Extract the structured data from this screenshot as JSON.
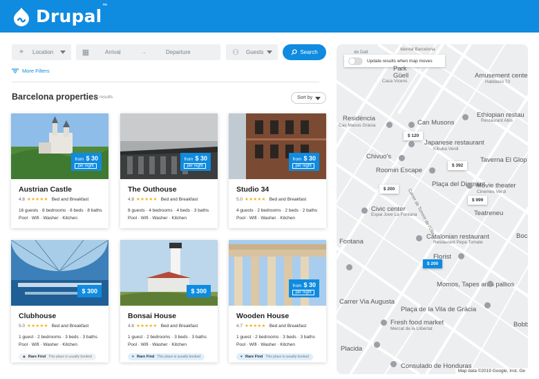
{
  "header": {
    "brand": "Drupal",
    "tm": "™"
  },
  "search": {
    "location_placeholder": "Location",
    "arrival_placeholder": "Arrival",
    "date_separator": "→",
    "departure_placeholder": "Departure",
    "guests_placeholder": "Guests",
    "search_label": "Search",
    "more_filters": "More Filters"
  },
  "results": {
    "title": "Barcelona properties",
    "count": "12 results",
    "sort_label": "Sort by"
  },
  "properties": [
    {
      "name": "Austrian Castle",
      "rating": "4.8",
      "stars": "★★★★★",
      "type": "Bed and Breakfast",
      "from": "from",
      "price": "$ 30",
      "per_night": "per night",
      "features1": "16 guests · 8 bedrooms · 8 beds · 8 baths",
      "features2": "Pool · Wifi · Washer · Kitchen"
    },
    {
      "name": "The Outhouse",
      "rating": "4.8",
      "stars": "★★★★★",
      "type": "Bed and Breakfast",
      "from": "from",
      "price": "$ 30",
      "per_night": "per night",
      "features1": "8 guests · 4 bedrooms · 4 beds · 3 baths",
      "features2": "Pool · Wifi · Washer · Kitchen"
    },
    {
      "name": "Studio 34",
      "rating": "5.0",
      "stars": "★★★★★",
      "type": "Bed and Breakfast",
      "from": "from",
      "price": "$ 30",
      "per_night": "per night",
      "features1": "4 guests · 2 bedrooms · 2 beds · 2 baths",
      "features2": "Pool · Wifi · Washer · Kitchen"
    },
    {
      "name": "Clubhouse",
      "rating": "5.0",
      "stars": "★★★★★",
      "type": "Bed and Breakfast",
      "price": "$ 300",
      "features1": "1 guest · 2 bedrooms · 3 beds · 3 baths",
      "features2": "Pool · Wifi · Washer · Kitchen",
      "badge_title": "Rare Find",
      "badge_text": "This place is usually booked"
    },
    {
      "name": "Bonsai House",
      "rating": "4.8",
      "stars": "★★★★★",
      "type": "Bed and Breakfast",
      "price": "$ 300",
      "features1": "1 guest · 2 bedrooms · 3 beds · 3 baths",
      "features2": "Pool · Wifi · Washer · Kitchen",
      "badge_title": "Rare Find",
      "badge_text": "This place is usually booked"
    },
    {
      "name": "Wooden House",
      "rating": "4.7",
      "stars": "★★★★★",
      "type": "Bed and Breakfast",
      "from": "from",
      "price": "$ 30",
      "per_night": "per night",
      "features1": "1 guest · 2 bedrooms · 3 beds · 3 baths",
      "features2": "Pool · Wifi · Washer · Kitchen",
      "badge_title": "Rare Find",
      "badge_text": "This place is usually booked"
    }
  ],
  "map": {
    "toggle_label": "Update results when map moves",
    "labels": [
      "Park",
      "Güell",
      "Casa Vicens",
      "Amusement center",
      "Habitacio 73",
      "Residència",
      "Cas Masos Gràcia",
      "Can Musons",
      "Ethiopian restau",
      "Restaurant Abis",
      "Japanese restaurant",
      "Kibuka Verdi",
      "Chivuo's",
      "Taverna El Glop",
      "Roomin Escape",
      "Plaça del Diamant",
      "Movie theater",
      "Cinemes Verdi",
      "Civic center",
      "Espai Jove La Fontana",
      "Teatreneu",
      "Fontana",
      "Catalonian restaurant",
      "Restaurant Pepa Tomate",
      "Florist",
      "Momos, Tapes amb pallios",
      "Carrer de Torrent de l'Olla",
      "Carrer Via Augusta",
      "Plaça de la Vila de Gràcia",
      "Fresh food market",
      "Mercat de la Llibertat",
      "Placida",
      "Consulado de Honduras",
      "Bobby",
      "Boca",
      "de Dalt",
      "Idental Barcelona"
    ],
    "price_markers": [
      "$ 120",
      "$ 392",
      "$ 200",
      "$ 999",
      "$ 200"
    ],
    "footer": "Map data ©2019 Google, Inst. Ge"
  },
  "colors": {
    "brand_blue": "#0f8be0",
    "star": "#f2b01e"
  }
}
